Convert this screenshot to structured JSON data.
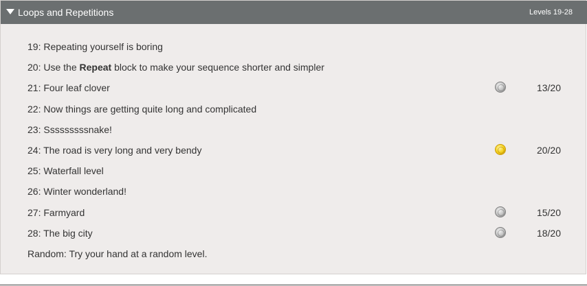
{
  "header": {
    "title": "Loops and Repetitions",
    "range": "Levels 19-28"
  },
  "levels": [
    {
      "label": "19: Repeating yourself is boring"
    },
    {
      "label_pre": "20: Use the ",
      "label_bold": "Repeat",
      "label_post": " block to make your sequence shorter and simpler"
    },
    {
      "label": "21: Four leaf clover",
      "medal": "silver-medal-icon",
      "score": "13/20"
    },
    {
      "label": "22: Now things are getting quite long and complicated"
    },
    {
      "label": "23: Sssssssssnake!"
    },
    {
      "label": "24: The road is very long and very bendy",
      "medal": "gold-medal-icon",
      "score": "20/20"
    },
    {
      "label": "25: Waterfall level"
    },
    {
      "label": "26: Winter wonderland!"
    },
    {
      "label": "27: Farmyard",
      "medal": "silver-medal-icon",
      "score": "15/20"
    },
    {
      "label": "28: The big city",
      "medal": "silver-medal-icon",
      "score": "18/20"
    },
    {
      "label": "Random: Try your hand at a random level."
    }
  ],
  "colors": {
    "header_bg": "#6b6f70",
    "panel_bg": "#efeceb",
    "text": "#333333",
    "gold": "#f5d21e",
    "silver": "#c9c9c9"
  }
}
